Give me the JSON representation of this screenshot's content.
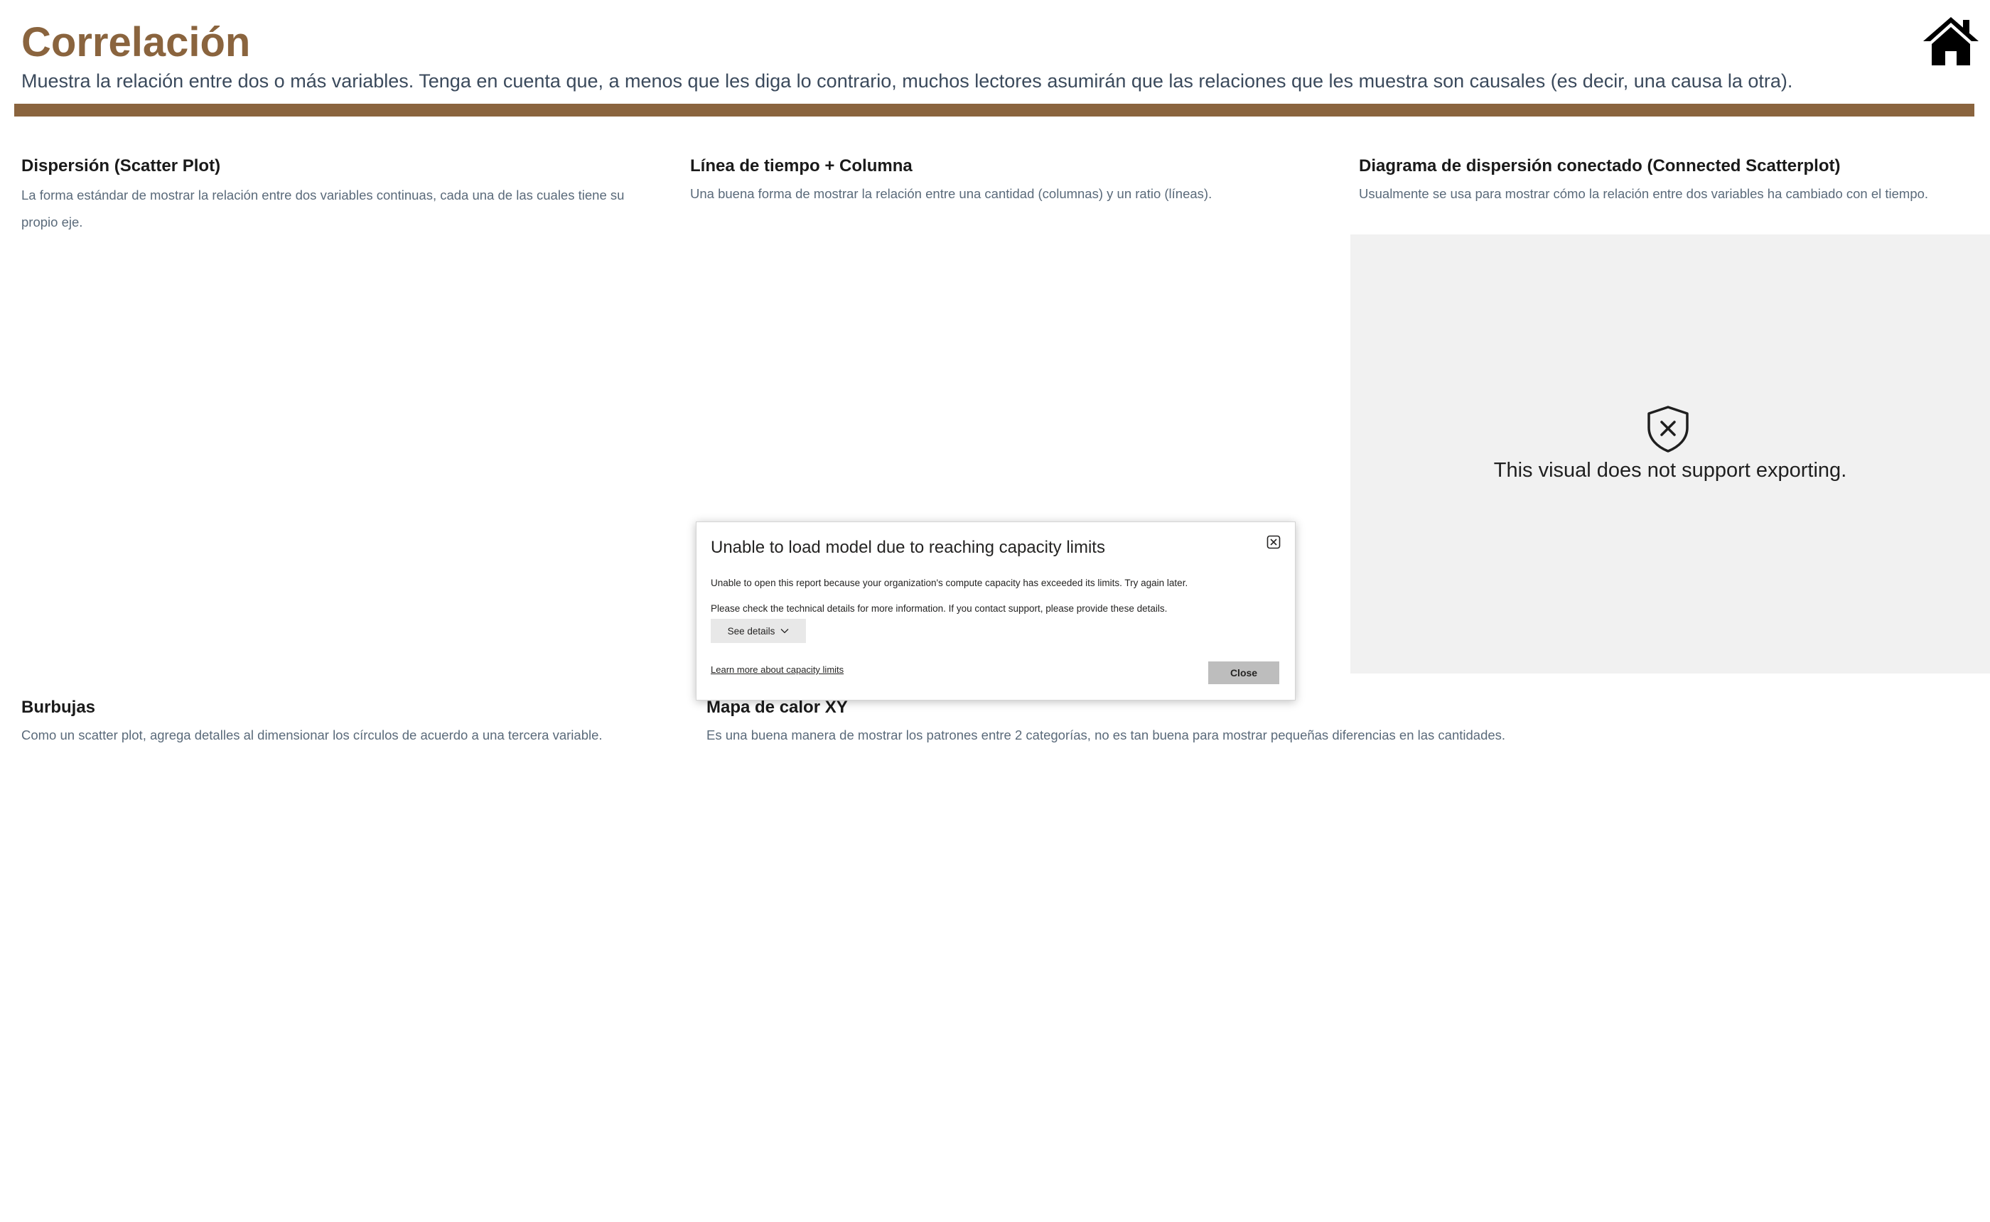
{
  "page": {
    "title": "Correlación",
    "subtitle": "Muestra la relación entre dos o más variables. Tenga en cuenta que, a menos que les diga lo contrario, muchos lectores asumirán que las relaciones que les muestra son causales (es decir, una causa la otra)."
  },
  "sections": {
    "scatter": {
      "title": "Dispersión (Scatter Plot)",
      "desc": "La forma estándar de mostrar la relación entre dos variables continuas, cada una de las cuales tiene su propio eje."
    },
    "timeline": {
      "title": "Línea de tiempo + Columna",
      "desc": "Una buena forma de mostrar la relación entre una cantidad (columnas) y un ratio (líneas)."
    },
    "connected": {
      "title": "Diagrama de dispersión conectado (Connected Scatterplot)",
      "desc": "Usualmente se usa para mostrar cómo la relación entre dos variables ha cambiado con el tiempo."
    },
    "bubbles": {
      "title": "Burbujas",
      "desc": "Como un scatter plot, agrega detalles al dimensionar los círculos de acuerdo a una tercera variable."
    },
    "heatmap": {
      "title": "Mapa de calor XY",
      "desc": "Es una buena manera de mostrar los patrones entre 2 categorías, no es tan buena para mostrar pequeñas diferencias en las cantidades."
    }
  },
  "placeholder": {
    "message": "This visual does not support exporting."
  },
  "dialog": {
    "title": "Unable to load model due to reaching capacity limits",
    "message": "Unable to open this report because your organization's compute capacity has exceeded its limits. Try again later.",
    "details_note": "Please check the technical details for more information. If you contact support, please provide these details.",
    "see_details_label": "See details",
    "learn_more_label": "Learn more about capacity limits",
    "close_label": "Close"
  },
  "colors": {
    "accent": "#8a643e",
    "placeholder_bg": "#f1f1f1"
  },
  "icons": {
    "home": "home-icon",
    "shield": "shield-x-icon",
    "dialog_close": "close-icon",
    "chevron": "chevron-down-icon"
  }
}
